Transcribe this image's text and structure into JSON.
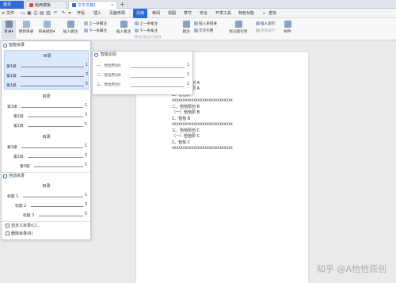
{
  "tabs": {
    "home": "首页",
    "template": "稻壳模板",
    "document": "文字文稿1"
  },
  "menu": {
    "file": "文件",
    "items": [
      "开始",
      "插入",
      "页面布局",
      "引用",
      "审阅",
      "视图",
      "章节",
      "安全",
      "开发工具",
      "特色功能"
    ],
    "active_index": 3,
    "search": "查找"
  },
  "ribbon": {
    "toc": "目录",
    "update_toc": "更新目录",
    "toc_level": "目录级别",
    "insert_footnote": "插入脚注",
    "prev_footnote": "上一条脚注",
    "next_footnote": "下一条脚注",
    "footnote_endnote": "脚注/尾注分隔线",
    "insert_endnote": "插入尾注",
    "prev_endnote": "上一条尾注",
    "next_endnote": "下一条尾注",
    "caption": "题注",
    "insert_table_of_figures": "插入表目录",
    "cross_ref": "交叉引用",
    "mark_entry": "标记索引项",
    "insert_index": "插入索引",
    "update_index": "更新索引",
    "mail": "邮件"
  },
  "panel": {
    "smart_header": "智能目录",
    "auto_header": "自动目录",
    "card1": {
      "title": "目录",
      "rows": [
        {
          "label": "第1级",
          "num": "1"
        },
        {
          "label": "第1级",
          "num": "3"
        },
        {
          "label": "第1级",
          "num": "5"
        }
      ]
    },
    "card2": {
      "title": "目录",
      "rows": [
        {
          "label": "第1级",
          "num": "1"
        },
        {
          "label": "第2级",
          "num": "3"
        },
        {
          "label": "第2级",
          "num": "5"
        }
      ]
    },
    "card3": {
      "title": "目录",
      "rows": [
        {
          "label": "第1级",
          "num": "1"
        },
        {
          "label": "第2级",
          "num": "3"
        },
        {
          "label": "第3级",
          "num": "5"
        }
      ]
    },
    "card4": {
      "title": "目录",
      "rows": [
        {
          "label": "标题 1",
          "num": "1"
        },
        {
          "label": "标题 2",
          "num": "3"
        },
        {
          "label": "标题 3",
          "num": "5"
        }
      ]
    },
    "custom_toc": "自定义目录(C)...",
    "delete_toc": "删除目录(R)"
  },
  "smart_popup": {
    "header": "智能识别",
    "rows": [
      {
        "label": "一、恰恰原创A",
        "num": "1"
      },
      {
        "label": "二、恰恰原创B",
        "num": "1"
      },
      {
        "label": "三、恰恰原创C",
        "num": "1"
      }
    ]
  },
  "document": {
    "lines": [
      "一、恰恰原创 A",
      "（一）恰恰原 A",
      "1、恰恰原",
      "XXXXXXXXXXXXXXXXXXXXXXXXXXXX",
      "二、恰恰原创 B",
      "（一）恰恰原 B",
      "1、恰恰 B",
      "XXXXXXXXXXXXXXXXXXXXXXXXXXXX",
      "三、恰恰原创 C",
      "（一）恰恰原 C",
      "1、恰恰 C",
      "XXXXXXXXXXXXXXXXXXXXXXXXXXXX"
    ]
  },
  "watermark": "知乎 @A恰恰原创",
  "colors": {
    "accent": "#2e6bd6",
    "highlight": "#dce8fb"
  }
}
